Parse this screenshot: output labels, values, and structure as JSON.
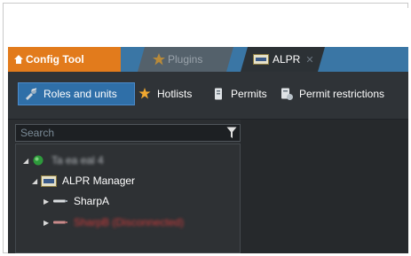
{
  "tabs": [
    {
      "label": "Config Tool",
      "icon": "home-icon"
    },
    {
      "label": "Plugins",
      "icon": "star-icon"
    },
    {
      "label": "ALPR",
      "icon": "alpr-icon",
      "close": "✕"
    }
  ],
  "toolbar": {
    "items": [
      {
        "label": "Roles and units",
        "icon": "roles-units-icon"
      },
      {
        "label": "Hotlists",
        "icon": "hotlist-icon"
      },
      {
        "label": "Permits",
        "icon": "permits-icon"
      },
      {
        "label": "Permit restrictions",
        "icon": "permit-restrictions-icon"
      }
    ]
  },
  "search": {
    "placeholder": "Search"
  },
  "tree": {
    "root_label": "Ta ea eal 4",
    "manager_label": "ALPR Manager",
    "unit1_label": "SharpA",
    "unit2_label": "SharpB (Disconnected)"
  },
  "colors": {
    "accent": "#e27b1c",
    "selected": "#2f6fa8",
    "toolbar": "#2f3337",
    "offline": "#d03c3c"
  }
}
